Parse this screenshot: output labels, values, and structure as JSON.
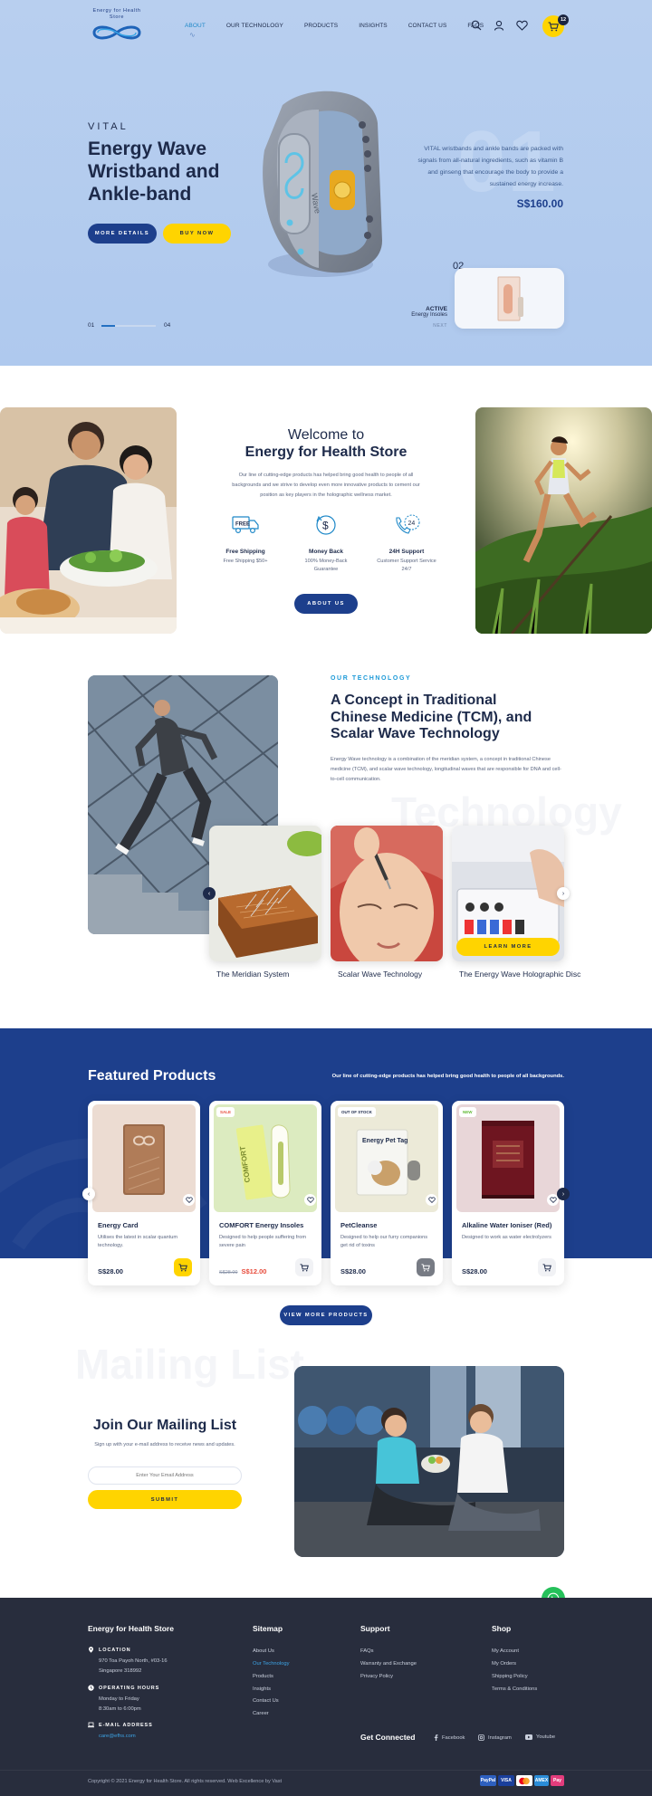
{
  "header": {
    "logo_text": "Energy for Health Store",
    "nav": [
      "ABOUT",
      "OUR TECHNOLOGY",
      "PRODUCTS",
      "INSIGHTS",
      "CONTACT US",
      "FAQS"
    ],
    "active_nav": "ABOUT",
    "cart_count": "12",
    "icons": [
      "search-icon",
      "user-icon",
      "heart-icon",
      "cart-icon"
    ]
  },
  "hero": {
    "eyebrow": "VITAL",
    "title": "Energy Wave Wristband and Ankle-band",
    "more_details": "MORE DETAILS",
    "buy_now": "BUY NOW",
    "index_current": "01",
    "index_total": "04",
    "progress": 0.25,
    "big_number": "01",
    "description": "VITAL wristbands and ankle bands are packed with signals from all-natural ingredients, such as vitamin B and ginseng that encourage the body to provide a sustained energy increase.",
    "price": "S$160.00",
    "next_number": "02",
    "next_title_line1": "ACTIVE",
    "next_title_line2": "Energy Insoles",
    "next_sub": "NEXT"
  },
  "welcome": {
    "heading_line1": "Welcome to",
    "heading_line2": "Energy for Health Store",
    "description": "Our line of cutting-edge products has helped bring good health to people of all backgrounds and we strive to develop even more innovative products to cement our position as key players in the holographic wellness market.",
    "features": [
      {
        "title": "Free Shipping",
        "sub": "Free Shipping $50+"
      },
      {
        "title": "Money Back",
        "sub": "100% Money-Back Guarantee"
      },
      {
        "title": "24H Support",
        "sub": "Customer Support Service 24/7"
      }
    ],
    "about_button": "ABOUT US"
  },
  "technology": {
    "eyebrow": "OUR TECHNOLOGY",
    "title": "A Concept in Traditional Chinese Medicine (TCM), and Scalar Wave Technology",
    "description": "Energy Wave technology is a combination of the meridian system, a concept in traditional Chinese medicine (TCM), and scalar wave technology, longitudinal waves that are responsible for DNA and cell-to-cell communication.",
    "watermark": "Technology",
    "cards": [
      {
        "label": "The Meridian System"
      },
      {
        "label": "Scalar Wave Technology"
      },
      {
        "label": "The Energy Wave Holographic Disc"
      }
    ],
    "learn_more": "LEARN MORE"
  },
  "featured": {
    "title": "Featured Products",
    "description": "Our line of cutting-edge products has helped bring good health to people of all backgrounds.",
    "products": [
      {
        "name": "Energy Card",
        "desc": "Utilises the latest in scalar quantum technology.",
        "price": "S$28.00",
        "old_price": "",
        "badge": ""
      },
      {
        "name": "COMFORT Energy Insoles",
        "desc": "Designed to help people suffering from severe pain",
        "price": "S$12.00",
        "old_price": "S$28.00",
        "badge": "SALE"
      },
      {
        "name": "PetCleanse",
        "desc": "Designed to help our furry companions get rid of toxins",
        "price": "S$28.00",
        "old_price": "",
        "badge": "OUT OF STOCK"
      },
      {
        "name": "Alkaline Water Ioniser (Red)",
        "desc": "Designed to work as water electrolyzers",
        "price": "S$28.00",
        "old_price": "",
        "badge": "NEW"
      }
    ],
    "view_more": "VIEW MORE PRODUCTS"
  },
  "mailing": {
    "watermark": "Mailing List",
    "title": "Join Our Mailing List",
    "description": "Sign up with your e-mail address to receive news and updates.",
    "placeholder": "Enter Your Email Address",
    "submit": "SUBMIT"
  },
  "footer": {
    "brand": "Energy for Health Store",
    "location_label": "LOCATION",
    "location": "970 Toa Payoh North, #03-16 Singapore 318992",
    "hours_label": "OPERATING HOURS",
    "hours": "Monday to Friday 8:30am to 6:00pm",
    "email_label": "E-MAIL ADDRESS",
    "email": "care@efhs.com",
    "sitemap_title": "Sitemap",
    "sitemap": [
      "About Us",
      "Our Technology",
      "Products",
      "Insights",
      "Contact Us",
      "Career"
    ],
    "support_title": "Support",
    "support": [
      "FAQs",
      "Warranty and Exchange",
      "Privacy Policy"
    ],
    "shop_title": "Shop",
    "shop": [
      "My Account",
      "My Orders",
      "Shipping Policy",
      "Terms & Conditions"
    ],
    "connected": "Get Connected",
    "socials": [
      "Facebook",
      "Instagram",
      "Youtube"
    ],
    "copyright": "Copyright © 2021 Energy for Health Store. All rights reserved. Web Excellence by Vast",
    "payments": [
      "PayPal",
      "VISA",
      "Mastercard",
      "AMEX",
      "Pay"
    ]
  },
  "colors": {
    "navy": "#1d3f8c",
    "yellow": "#ffd400",
    "hero_bg": "#b8cfef",
    "footer_bg": "#282d3d",
    "accent_blue": "#1e9ad8",
    "whatsapp": "#25c05a"
  }
}
